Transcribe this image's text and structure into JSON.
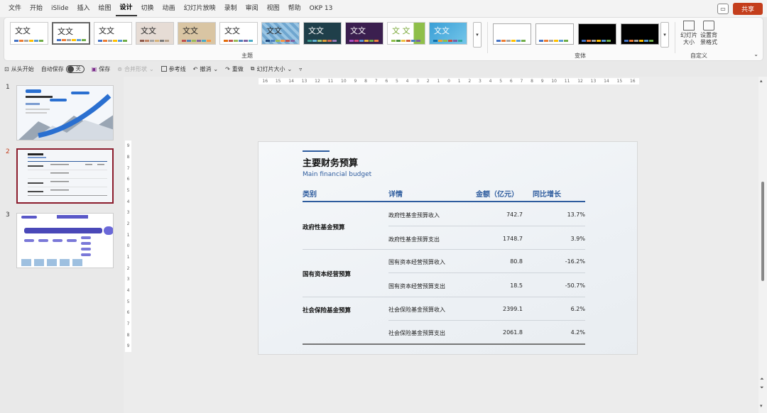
{
  "menu": [
    "文件",
    "开始",
    "iSlide",
    "插入",
    "绘图",
    "设计",
    "切换",
    "动画",
    "幻灯片放映",
    "录制",
    "审阅",
    "视图",
    "帮助",
    "OKP 13"
  ],
  "menu_active_index": 5,
  "share_label": "共享",
  "ribbon": {
    "theme_text": "文文",
    "theme_text_alt": "文 文",
    "themes_group_label": "主题",
    "variants_group_label": "变体",
    "custom_group_label": "自定义",
    "slide_size_label": "幻灯片大小",
    "bg_format_label": "设置背景格式"
  },
  "quick": {
    "from_start": "从头开始",
    "autosave": "自动保存",
    "autosave_state": "关",
    "save": "保存",
    "merge_shapes": "合并形状",
    "guides": "参考线",
    "undo": "撤消",
    "redo": "重做",
    "slide_size": "幻灯片大小"
  },
  "thumbnails": [
    {
      "number": "1"
    },
    {
      "number": "2"
    },
    {
      "number": "3"
    }
  ],
  "ruler_h": [
    "16",
    "15",
    "14",
    "13",
    "12",
    "11",
    "10",
    "9",
    "8",
    "7",
    "6",
    "5",
    "4",
    "3",
    "2",
    "1",
    "0",
    "1",
    "2",
    "3",
    "4",
    "5",
    "6",
    "7",
    "8",
    "9",
    "10",
    "11",
    "12",
    "13",
    "14",
    "15",
    "16"
  ],
  "ruler_v": [
    "9",
    "8",
    "7",
    "6",
    "5",
    "4",
    "3",
    "2",
    "1",
    "0",
    "1",
    "2",
    "3",
    "4",
    "5",
    "6",
    "7",
    "8",
    "9"
  ],
  "slide": {
    "title": "主要财务预算",
    "subtitle": "Main financial budget",
    "headers": {
      "category": "类别",
      "detail": "详情",
      "amount": "金额（亿元）",
      "growth": "同比增长"
    },
    "groups": [
      {
        "category": "政府性基金预算",
        "rows": [
          {
            "detail": "政府性基金预算收入",
            "amount": "742.7",
            "growth": "13.7%"
          },
          {
            "detail": "政府性基金预算支出",
            "amount": "1748.7",
            "growth": "3.9%"
          }
        ]
      },
      {
        "category": "国有资本经营预算",
        "rows": [
          {
            "detail": "国有资本经营预算收入",
            "amount": "80.8",
            "growth": "-16.2%"
          },
          {
            "detail": "国有资本经营预算支出",
            "amount": "18.5",
            "growth": "-50.7%"
          }
        ]
      },
      {
        "category": "社会保险基金预算",
        "rows": [
          {
            "detail": "社会保险基金预算收入",
            "amount": "2399.1",
            "growth": "6.2%"
          },
          {
            "detail": "社会保险基金预算支出",
            "amount": "2061.8",
            "growth": "4.2%"
          }
        ]
      }
    ]
  },
  "colors": {
    "accent": "#2e5c9e",
    "share": "#c43e1c",
    "selected_thumb": "#8b1c2c"
  }
}
